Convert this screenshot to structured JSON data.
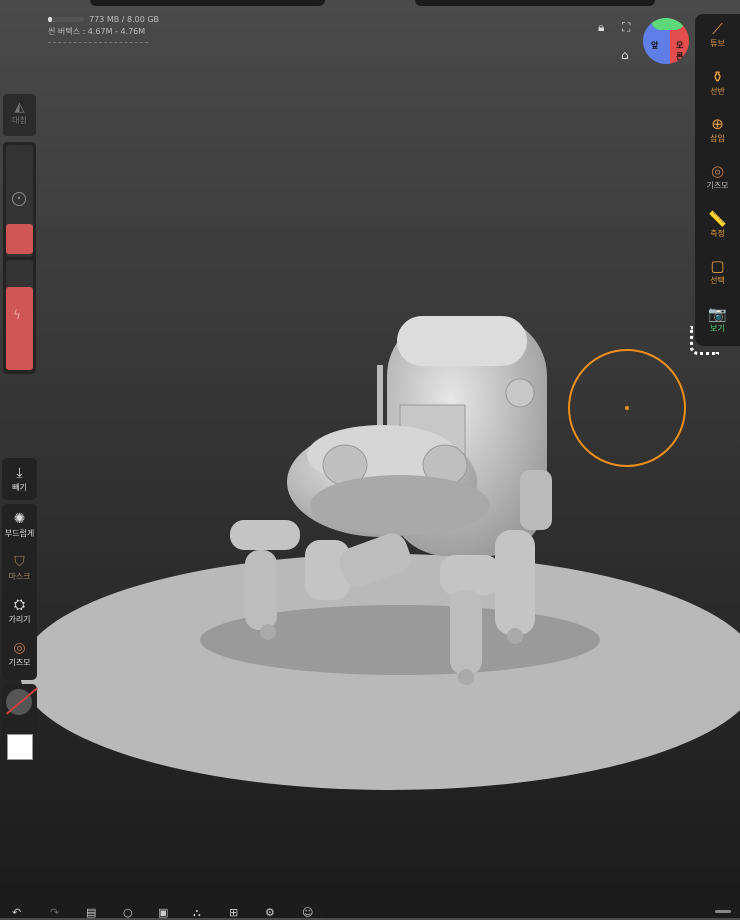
{
  "stats": {
    "memory": "773 MB / 8.00 GB",
    "memory_fraction": 0.1,
    "vertices": "씬 버텍스 : 4.67M - ",
    "faces": "4.76M"
  },
  "right_panel": {
    "items": [
      {
        "label": "튜브",
        "icon": "tube-icon",
        "glyph": "⟋"
      },
      {
        "label": "선반",
        "icon": "lathe-icon",
        "glyph": "⚱"
      },
      {
        "label": "삽입",
        "icon": "insert-icon",
        "glyph": "⊕"
      },
      {
        "label": "기즈모",
        "icon": "gizmo-icon",
        "glyph": "◎"
      },
      {
        "label": "측정",
        "icon": "ruler-icon",
        "glyph": "📏"
      },
      {
        "label": "선택",
        "icon": "select-icon",
        "glyph": "▢"
      },
      {
        "label": "보기",
        "icon": "camera-icon",
        "glyph": "📷"
      }
    ]
  },
  "view_cube": {
    "front_label": "앞",
    "right_label": "오른"
  },
  "left_panel": {
    "symmetry_label": "대칭",
    "tools": [
      {
        "label": "빼기",
        "icon": "subtract-icon",
        "glyph": "⤓"
      },
      {
        "label": "부드럽게",
        "icon": "smooth-icon",
        "glyph": "✺"
      },
      {
        "label": "마스크",
        "icon": "mask-icon",
        "glyph": "⛉"
      },
      {
        "label": "가리기",
        "icon": "hide-icon",
        "glyph": "⛭"
      },
      {
        "label": "기즈모",
        "icon": "gizmo-icon",
        "glyph": "◎"
      }
    ]
  },
  "colors": {
    "accent": "#f0901a",
    "slider_red": "#d05555",
    "active_green": "#5ed67a"
  }
}
